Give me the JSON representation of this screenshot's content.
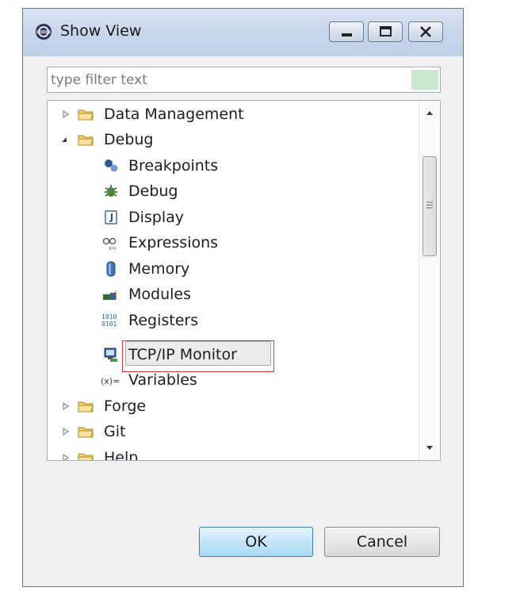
{
  "window": {
    "title": "Show View",
    "buttons": {
      "minimize_icon": "minimize-icon",
      "maximize_icon": "maximize-icon",
      "close_icon": "close-icon"
    }
  },
  "filter": {
    "placeholder": "type filter text",
    "value": ""
  },
  "tree": {
    "items": [
      {
        "label": "Data Management",
        "type": "folder",
        "expanded": false,
        "icon": "folder-icon"
      },
      {
        "label": "Debug",
        "type": "folder",
        "expanded": true,
        "icon": "folder-icon"
      },
      {
        "label": "Breakpoints",
        "type": "view",
        "icon": "breakpoints-icon"
      },
      {
        "label": "Debug",
        "type": "view",
        "icon": "debug-bug-icon"
      },
      {
        "label": "Display",
        "type": "view",
        "icon": "display-icon"
      },
      {
        "label": "Expressions",
        "type": "view",
        "icon": "expressions-icon"
      },
      {
        "label": "Memory",
        "type": "view",
        "icon": "memory-icon"
      },
      {
        "label": "Modules",
        "type": "view",
        "icon": "modules-icon"
      },
      {
        "label": "Registers",
        "type": "view",
        "icon": "registers-icon"
      },
      {
        "label": "TCP/IP Monitor",
        "type": "view",
        "icon": "tcpip-monitor-icon",
        "selected": true
      },
      {
        "label": "Variables",
        "type": "view",
        "icon": "variables-icon"
      },
      {
        "label": "Forge",
        "type": "folder",
        "expanded": false,
        "icon": "folder-icon"
      },
      {
        "label": "Git",
        "type": "folder",
        "expanded": false,
        "icon": "folder-icon"
      },
      {
        "label": "Help",
        "type": "folder",
        "expanded": false,
        "icon": "folder-icon"
      }
    ]
  },
  "buttons": {
    "ok": "OK",
    "cancel": "Cancel"
  },
  "colors": {
    "highlight_outline": "#e5343c",
    "ok_border": "#3c7fb1",
    "filter_clear": "#c9e8cc"
  }
}
